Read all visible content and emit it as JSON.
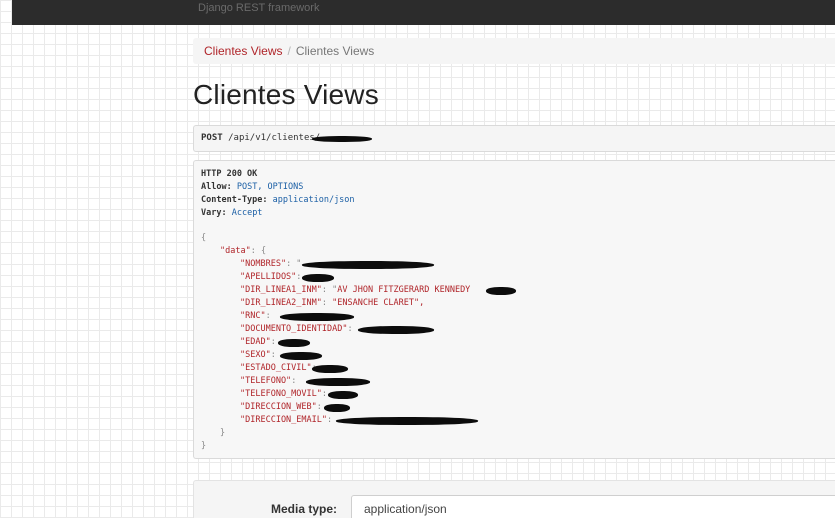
{
  "topbar": {
    "brand": "Django REST framework"
  },
  "breadcrumb": [
    {
      "label": "Clientes Views"
    },
    {
      "label": "Clientes Views"
    }
  ],
  "page_title": "Clientes Views",
  "request": {
    "method": "POST",
    "path": "/api/v1/clientes/"
  },
  "response": {
    "status": "HTTP 200 OK",
    "headers": [
      {
        "key": "Allow:",
        "value": "POST, OPTIONS"
      },
      {
        "key": "Content-Type:",
        "value": "application/json"
      },
      {
        "key": "Vary:",
        "value": "Accept"
      }
    ],
    "open_brace": "{",
    "close_brace": "}",
    "data_key": "\"data\"",
    "data_open": ": {",
    "data_close": "}",
    "fields": [
      {
        "key": "\"NOMBRES\"",
        "sep": ": \"",
        "value": "",
        "redacted": true
      },
      {
        "key": "\"APELLIDOS\"",
        "sep": ":",
        "value": "",
        "redacted": true
      },
      {
        "key": "\"DIR_LINEA1_INM\"",
        "sep": ": \"",
        "value": "AV JHON FITZGERARD KENNEDY",
        "redacted": true
      },
      {
        "key": "\"DIR_LINEA2_INM\"",
        "sep": ": ",
        "value": "\"ENSANCHE CLARET\",",
        "redacted": false
      },
      {
        "key": "\"RNC\"",
        "sep": ":",
        "value": "",
        "redacted": true
      },
      {
        "key": "\"DOCUMENTO_IDENTIDAD\"",
        "sep": ":",
        "value": "",
        "redacted": true
      },
      {
        "key": "\"EDAD\"",
        "sep": ":",
        "value": "",
        "redacted": true
      },
      {
        "key": "\"SEXO\"",
        "sep": ":",
        "value": "",
        "redacted": true
      },
      {
        "key": "\"ESTADO_CIVIL\"",
        "sep": ":",
        "value": "",
        "redacted": true
      },
      {
        "key": "\"TELEFONO\"",
        "sep": ":",
        "value": "",
        "redacted": true
      },
      {
        "key": "\"TELEFONO_MOVIL\"",
        "sep": ":",
        "value": "",
        "redacted": true
      },
      {
        "key": "\"DIRECCION_WEB\"",
        "sep": ":",
        "value": "",
        "redacted": true
      },
      {
        "key": "\"DIRECCION_EMAIL\"",
        "sep": ":",
        "value": "",
        "redacted": true
      }
    ]
  },
  "media_type": {
    "label": "Media type:",
    "value": "application/json"
  },
  "colors": {
    "link": "#b0252a",
    "header_value": "#1b5fa5",
    "topbar": "#2c2c2c"
  }
}
